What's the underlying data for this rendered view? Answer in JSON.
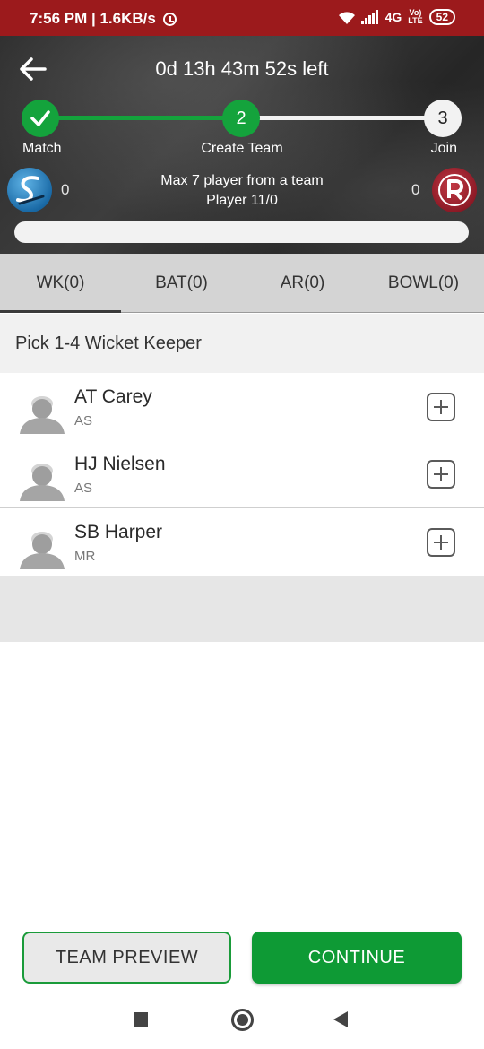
{
  "status_bar": {
    "time_speed": "7:56 PM | 1.6KB/s",
    "network": "4G",
    "lte_top": "Vo)",
    "lte_bottom": "LTE",
    "battery": "52"
  },
  "header": {
    "timer": "0d 13h 43m 52s left",
    "steps": [
      {
        "label": "Match",
        "number": "",
        "state": "done"
      },
      {
        "label": "Create Team",
        "number": "2",
        "state": "current"
      },
      {
        "label": "Join",
        "number": "3",
        "state": "pending"
      }
    ],
    "team_left": {
      "count": "0",
      "logo": "team-logo-s"
    },
    "team_right": {
      "count": "0",
      "logo": "team-logo-r"
    },
    "max_info": "Max 7 player from a team",
    "player_info": "Player 11/0",
    "player_progress": 0
  },
  "tabs": [
    {
      "label": "WK(0)",
      "active": true
    },
    {
      "label": "BAT(0)",
      "active": false
    },
    {
      "label": "AR(0)",
      "active": false
    },
    {
      "label": "BOWL(0)",
      "active": false
    }
  ],
  "pick_header": "Pick 1-4 Wicket Keeper",
  "players": [
    {
      "name": "AT Carey",
      "team": "AS"
    },
    {
      "name": "HJ Nielsen",
      "team": "AS"
    },
    {
      "name": "SB Harper",
      "team": "MR"
    }
  ],
  "buttons": {
    "team_preview": "TEAM PREVIEW",
    "continue": "CONTINUE"
  },
  "colors": {
    "status_bar": "#9c1a1c",
    "accent_green": "#0e9a35"
  }
}
